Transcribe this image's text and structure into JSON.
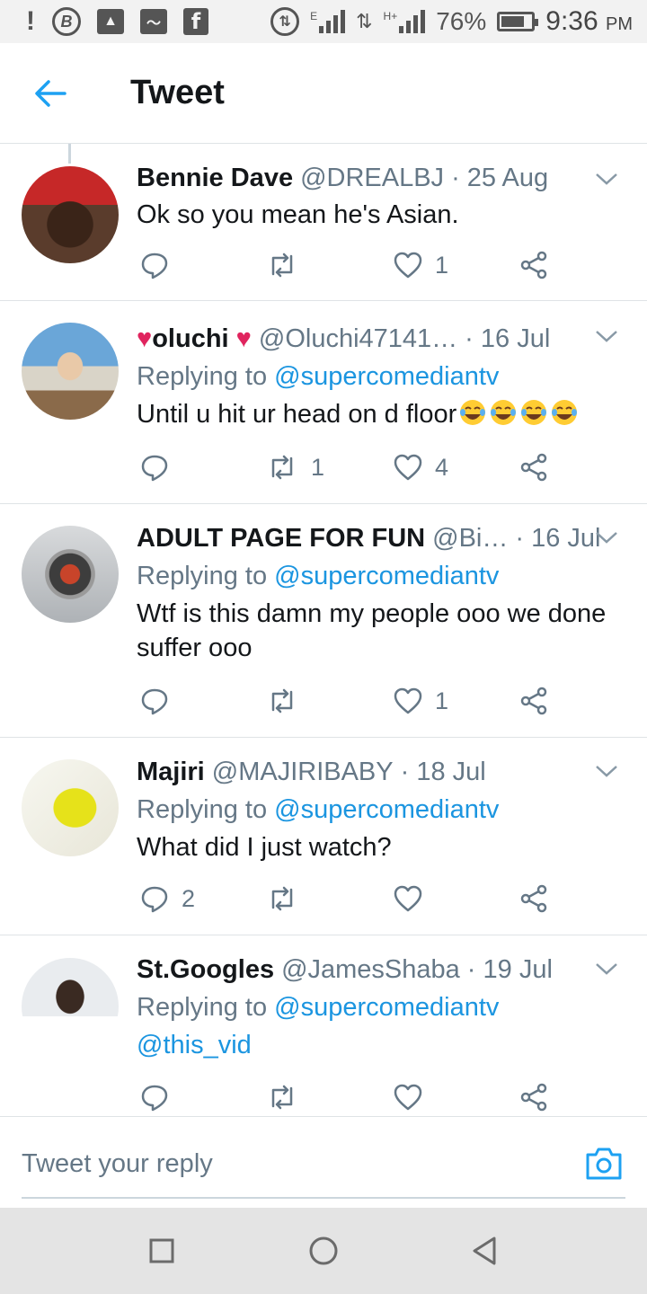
{
  "status_bar": {
    "left_icons": [
      "alert-icon",
      "bitcoin-icon",
      "gallery-icon",
      "activity-icon",
      "facebook-icon"
    ],
    "network_label_1": "E",
    "network_label_2": "H+",
    "battery": "76%",
    "battery_level": 0.76,
    "time": "9:36",
    "ampm": "PM"
  },
  "header": {
    "title": "Tweet",
    "back_icon": "arrow-left-icon"
  },
  "tweets": [
    {
      "name": "Bennie Dave",
      "handle": "@DREALBJ",
      "date": "· 25 Aug",
      "text": "Ok so you mean he's Asian.",
      "replies": "",
      "retweets": "",
      "likes": "1"
    },
    {
      "name_prefix": "♥",
      "name": "oluchi",
      "name_suffix": "♥",
      "handle": "@Oluchi47141…",
      "date": "· 16 Jul",
      "replying_label": "Replying to",
      "replying_to": "@supercomediantv",
      "text": "Until u hit ur head on d floor",
      "emoji_icon": "tears-of-joy-emoji",
      "replies": "",
      "retweets": "1",
      "likes": "4"
    },
    {
      "name": "ADULT PAGE FOR FUN",
      "handle": "@Bi…",
      "date": "· 16 Jul",
      "replying_label": "Replying to",
      "replying_to": "@supercomediantv",
      "text": "Wtf is this damn my people ooo we done suffer ooo",
      "replies": "",
      "retweets": "",
      "likes": "1"
    },
    {
      "name": "Majiri",
      "handle": "@MAJIRIBABY",
      "date": "· 18 Jul",
      "replying_label": "Replying to",
      "replying_to": "@supercomediantv",
      "text": "What did I just watch?",
      "replies": "2",
      "retweets": "",
      "likes": ""
    },
    {
      "name": "St.Googles",
      "handle": "@JamesShaba",
      "date": "· 19 Jul",
      "replying_label": "Replying to",
      "replying_to": "@supercomediantv",
      "text": "@this_vid",
      "replies": "",
      "retweets": "",
      "likes": ""
    }
  ],
  "composer": {
    "placeholder": "Tweet your reply",
    "camera_icon": "camera-icon"
  },
  "nav": [
    "recents-square-icon",
    "home-circle-icon",
    "back-triangle-icon"
  ]
}
